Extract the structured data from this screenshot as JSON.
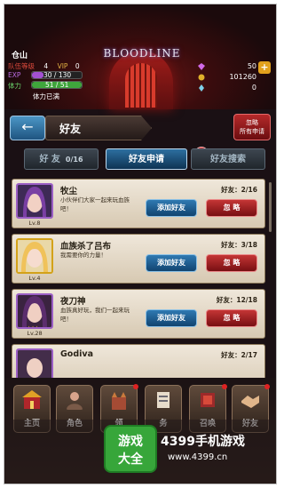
{
  "player": {
    "name": "仓山",
    "team_level_label": "队伍等级",
    "team_level": "4",
    "vip_label": "VIP",
    "vip_level": "0",
    "exp_label": "EXP",
    "exp_text": "30 / 130",
    "exp_progress": 0.23,
    "stamina_label": "体力",
    "stamina_text": "51 / 51",
    "stamina_progress": 1.0,
    "stamina_status": "体力已满"
  },
  "logo_text": "BLOODLINE",
  "resources": {
    "diamonds": "50",
    "gold": "101260",
    "crystals": "0",
    "plus_label": "+"
  },
  "page": {
    "back_icon": "←",
    "title": "好友",
    "ignore_all_line1": "忽略",
    "ignore_all_line2": "所有申请"
  },
  "tabs": [
    {
      "label": "好 友",
      "count": "0/16"
    },
    {
      "label": "好友申请",
      "badge": "4"
    },
    {
      "label": "好友搜索"
    }
  ],
  "requests": [
    {
      "name": "牧尘",
      "message": "小伙伴们大家一起来玩血族吧！",
      "level": "Lv.8",
      "friends": "好友：2/16",
      "stars": "",
      "accent": "#8a4ec0"
    },
    {
      "name": "血族杀了吕布",
      "message": "我需要你的力量！",
      "level": "Lv.4",
      "friends": "好友：3/18",
      "stars": "",
      "accent": "#d3a21a"
    },
    {
      "name": "夜刀神",
      "message": "血族真好玩，我们一起来玩吧！",
      "level": "Lv.28",
      "friends": "好友：12/18",
      "stars": "★★★",
      "accent": "#8a4ec0"
    },
    {
      "name": "Godiva",
      "message": "",
      "level": "",
      "friends": "好友：2/17",
      "stars": "",
      "accent": "#8a4ec0"
    }
  ],
  "buttons": {
    "add": "添加好友",
    "ignore": "忽 略"
  },
  "nav": [
    {
      "label": "主页",
      "icon": "home-icon",
      "color": "#b0262a"
    },
    {
      "label": "角色",
      "icon": "character-icon",
      "color": "#7a5a48"
    },
    {
      "label": "领",
      "icon": "castle-icon",
      "color": "#a54b34"
    },
    {
      "label": "务",
      "icon": "task-icon",
      "color": "#6c6a72"
    },
    {
      "label": "召唤",
      "icon": "summon-icon",
      "color": "#9c2a2a"
    },
    {
      "label": "好友",
      "icon": "handshake-icon",
      "color": "#b9733b"
    }
  ],
  "watermark": {
    "logo_line1": "游戏",
    "logo_line2": "大全",
    "title": "4399手机游戏",
    "url": "www.4399.cn"
  }
}
